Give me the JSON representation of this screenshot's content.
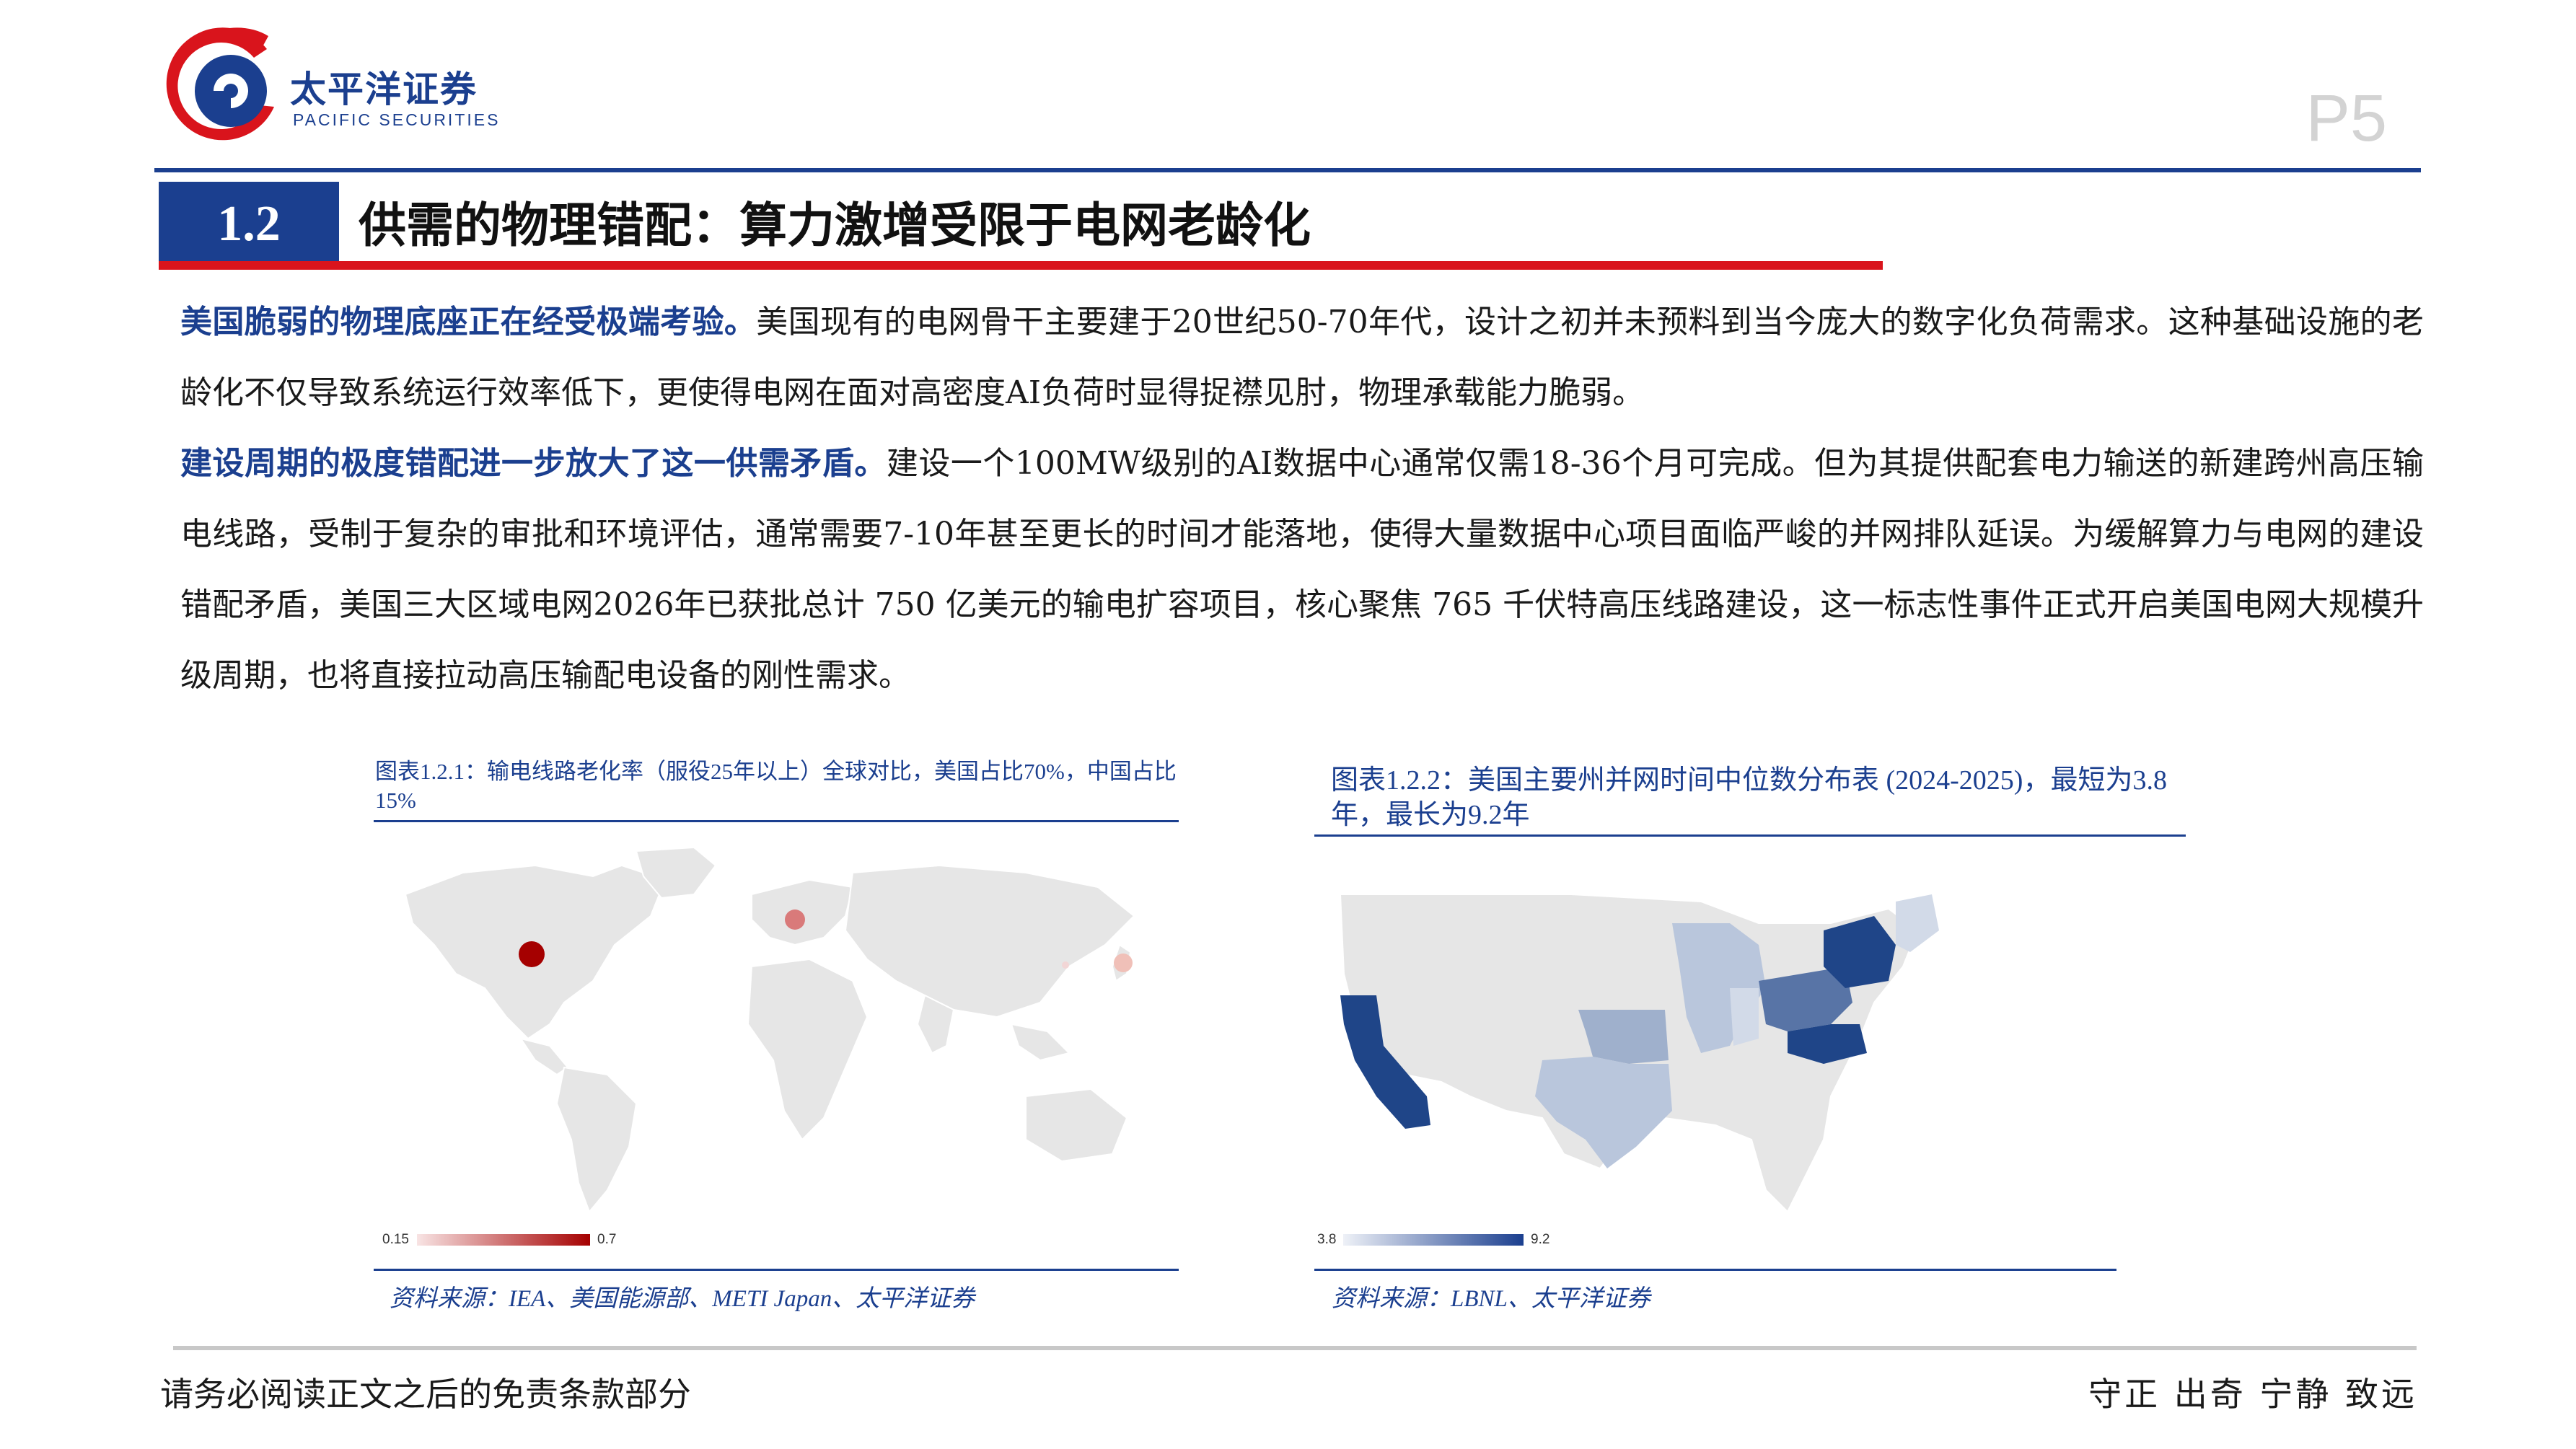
{
  "brand": {
    "name_cn": "太平洋证券",
    "name_en": "PACIFIC SECURITIES",
    "colors": {
      "primary": "#1b3f8f",
      "accent": "#d9141c"
    }
  },
  "page": {
    "number": "P5"
  },
  "section": {
    "number": "1.2",
    "title": "供需的物理错配：算力激增受限于电网老龄化"
  },
  "paragraphs": [
    {
      "lead": "美国脆弱的物理底座正在经受极端考验。",
      "body": "美国现有的电网骨干主要建于20世纪50-70年代，设计之初并未预料到当今庞大的数字化负荷需求。这种基础设施的老龄化不仅导致系统运行效率低下，更使得电网在面对高密度AI负荷时显得捉襟见肘，物理承载能力脆弱。"
    },
    {
      "lead": "建设周期的极度错配进一步放大了这一供需矛盾。",
      "body": "建设一个100MW级别的AI数据中心通常仅需18-36个月可完成。但为其提供配套电力输送的新建跨州高压输电线路，受制于复杂的审批和环境评估，通常需要7-10年甚至更长的时间才能落地，使得大量数据中心项目面临严峻的并网排队延误。为缓解算力与电网的建设错配矛盾，美国三大区域电网2026年已获批总计 750 亿美元的输电扩容项目，核心聚焦 765 千伏特高压线路建设，这一标志性事件正式开启美国电网大规模升级周期，也将直接拉动高压输配电设备的刚性需求。"
    }
  ],
  "figures": [
    {
      "caption": "图表1.2.1：输电线路老化率（服役25年以上）全球对比，美国占比70%，中国占比15%",
      "legend": {
        "min": "0.15",
        "max": "0.7",
        "color_low": "#f8e4e4",
        "color_high": "#a50000"
      },
      "source": "资料来源：IEA、美国能源部、METI Japan、太平洋证券"
    },
    {
      "caption": "图表1.2.2：美国主要州并网时间中位数分布表 (2024-2025)，最短为3.8年，最长为9.2年",
      "legend": {
        "min": "3.8",
        "max": "9.2",
        "color_low": "#eef1f7",
        "color_high": "#1b3f8f"
      },
      "source": "资料来源：LBNL、太平洋证券"
    }
  ],
  "footer": {
    "disclaimer": "请务必阅读正文之后的免责条款部分",
    "motto": "守正 出奇 宁静 致远"
  }
}
